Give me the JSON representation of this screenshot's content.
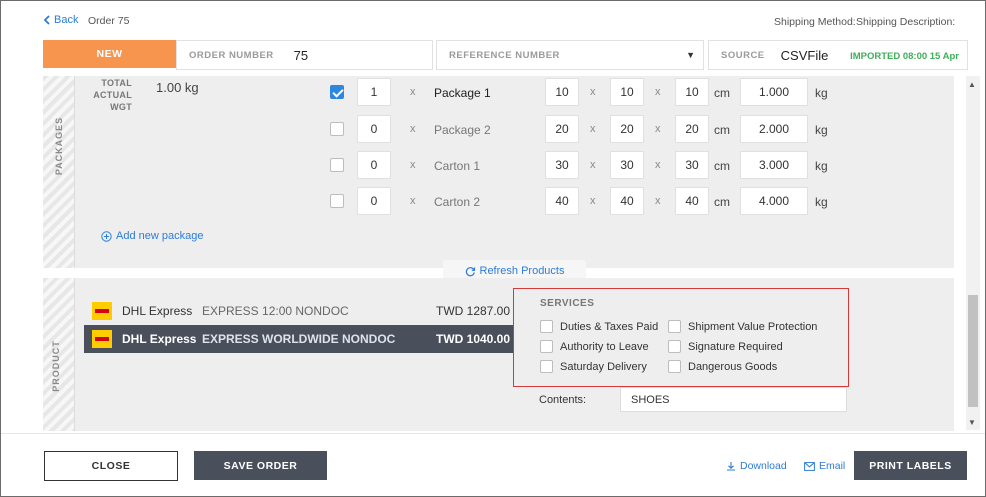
{
  "header": {
    "back_label": "Back",
    "order_title": "Order 75",
    "shipping_method_label": "Shipping Method:",
    "shipping_description_label": "Shipping Description:"
  },
  "order_bar": {
    "status": "NEW",
    "order_number_label": "ORDER NUMBER",
    "order_number_value": "75",
    "reference_number_label": "REFERENCE NUMBER",
    "source_label": "SOURCE",
    "source_value": "CSVFile",
    "imported_text": "IMPORTED 08:00 15 Apr"
  },
  "packages": {
    "section_label": "PACKAGES",
    "total_weight_label_1": "TOTAL",
    "total_weight_label_2": "ACTUAL",
    "total_weight_label_3": "WGT",
    "total_weight_value": "1.00 kg",
    "dim_unit": "cm",
    "weight_unit": "kg",
    "multiply_symbol": "x",
    "rows": [
      {
        "checked": true,
        "qty": "1",
        "name": "Package 1",
        "l": "10",
        "w": "10",
        "h": "10",
        "weight": "1.000"
      },
      {
        "checked": false,
        "qty": "0",
        "name": "Package 2",
        "l": "20",
        "w": "20",
        "h": "20",
        "weight": "2.000"
      },
      {
        "checked": false,
        "qty": "0",
        "name": "Carton 1",
        "l": "30",
        "w": "30",
        "h": "30",
        "weight": "3.000"
      },
      {
        "checked": false,
        "qty": "0",
        "name": "Carton 2",
        "l": "40",
        "w": "40",
        "h": "40",
        "weight": "4.000"
      }
    ],
    "add_new_label": "Add new package"
  },
  "refresh_label": "Refresh Products",
  "product": {
    "section_label": "PRODUCT",
    "rows": [
      {
        "carrier": "DHL Express",
        "service": "EXPRESS 12:00 NONDOC",
        "price": "TWD 1287.00",
        "selected": false
      },
      {
        "carrier": "DHL Express",
        "service": "EXPRESS WORLDWIDE NONDOC",
        "price": "TWD 1040.00",
        "selected": true
      }
    ]
  },
  "services": {
    "title": "SERVICES",
    "left": [
      "Duties & Taxes Paid",
      "Authority to Leave",
      "Saturday Delivery"
    ],
    "right": [
      "Shipment Value Protection",
      "Signature Required",
      "Dangerous Goods"
    ]
  },
  "contents": {
    "label": "Contents:",
    "value": "SHOES"
  },
  "footer": {
    "close_label": "CLOSE",
    "save_label": "SAVE ORDER",
    "download_label": "Download",
    "email_label": "Email",
    "print_label": "PRINT LABELS"
  },
  "colors": {
    "status_orange": "#f7944e",
    "accent_blue": "#2e7cd6",
    "imported_green": "#3fae5a",
    "dark_button": "#4a4f5c",
    "services_border": "#d43a3a"
  }
}
